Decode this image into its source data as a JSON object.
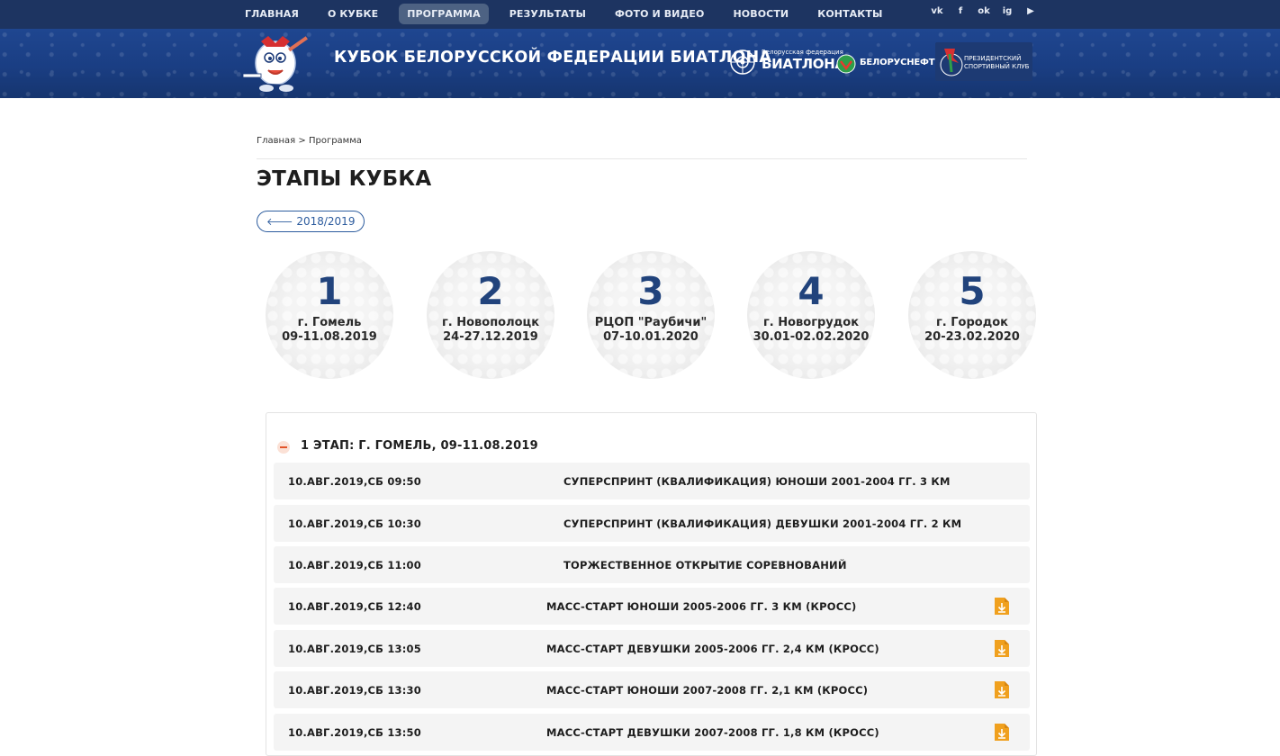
{
  "nav": {
    "items": [
      "ГЛАВНАЯ",
      "О КУБКЕ",
      "ПРОГРАММА",
      "РЕЗУЛЬТАТЫ",
      "ФОТО И ВИДЕО",
      "НОВОСТИ",
      "КОНТАКТЫ"
    ],
    "active": "ПРОГРАММА"
  },
  "socials": [
    {
      "icon": "vk-icon",
      "glyph": "vk"
    },
    {
      "icon": "facebook-icon",
      "glyph": "f"
    },
    {
      "icon": "odnoklassniki-icon",
      "glyph": "ok"
    },
    {
      "icon": "instagram-icon",
      "glyph": "ig"
    },
    {
      "icon": "youtube-icon",
      "glyph": "▶"
    }
  ],
  "header": {
    "title": "КУБОК БЕЛОРУССКОЙ ФЕДЕРАЦИИ БИАТЛОНА",
    "logos": {
      "bfb_small": "Белорусская федерация",
      "bfb_big": "БИАТЛОНА",
      "belorusneft": "БЕЛОРУСНЕФТЬ",
      "psk_line1": "ПРЕЗИДЕНТСКИЙ",
      "psk_line2": "СПОРТИВНЫЙ КЛУБ"
    }
  },
  "breadcrumb": {
    "home": "Главная",
    "separator": ">",
    "current": "Программа"
  },
  "page": {
    "title": "ЭТАПЫ КУБКА",
    "season_button": "2018/2019"
  },
  "stages": [
    {
      "number": "1",
      "city": "г. Гомель",
      "dates": "09-11.08.2019"
    },
    {
      "number": "2",
      "city": "г. Новополоцк",
      "dates": "24-27.12.2019"
    },
    {
      "number": "3",
      "city": "РЦОП \"Раубичи\"",
      "dates": "07-10.01.2020"
    },
    {
      "number": "4",
      "city": "г. Новогрудок",
      "dates": "30.01-02.02.2020"
    },
    {
      "number": "5",
      "city": "г. Городок",
      "dates": "20-23.02.2020"
    }
  ],
  "schedule": {
    "title": "1 ЭТАП: Г. ГОМЕЛЬ, 09-11.08.2019",
    "rows": [
      {
        "time": "10.АВГ.2019,СБ 09:50",
        "event": "СУПЕРСПРИНТ (КВАЛИФИКАЦИЯ) ЮНОШИ 2001-2004 ГГ. 3 КМ",
        "has_doc": false
      },
      {
        "time": "10.АВГ.2019,СБ 10:30",
        "event": "СУПЕРСПРИНТ (КВАЛИФИКАЦИЯ) ДЕВУШКИ 2001-2004 ГГ. 2 КМ",
        "has_doc": false
      },
      {
        "time": "10.АВГ.2019,СБ 11:00",
        "event": "ТОРЖЕСТВЕННОЕ ОТКРЫТИЕ СОРЕВНОВАНИЙ",
        "has_doc": false
      },
      {
        "time": "10.АВГ.2019,СБ 12:40",
        "event": "МАСС-СТАРТ ЮНОШИ 2005-2006 ГГ. 3 КМ (КРОСС)",
        "has_doc": true
      },
      {
        "time": "10.АВГ.2019,СБ 13:05",
        "event": "МАСС-СТАРТ ДЕВУШКИ 2005-2006 ГГ. 2,4 КМ (КРОСС)",
        "has_doc": true
      },
      {
        "time": "10.АВГ.2019,СБ 13:30",
        "event": "МАСС-СТАРТ ЮНОШИ 2007-2008 ГГ. 2,1 КМ (КРОСС)",
        "has_doc": true
      },
      {
        "time": "10.АВГ.2019,СБ 13:50",
        "event": "МАСС-СТАРТ ДЕВУШКИ 2007-2008 ГГ. 1,8 КМ (КРОСС)",
        "has_doc": true
      }
    ]
  },
  "colors": {
    "nav_bg": "#1d3461",
    "header_bg": "#1f4690",
    "accent_blue": "#21437c",
    "doc_icon": "#f0a01e",
    "minus_icon": "#e2542a"
  }
}
